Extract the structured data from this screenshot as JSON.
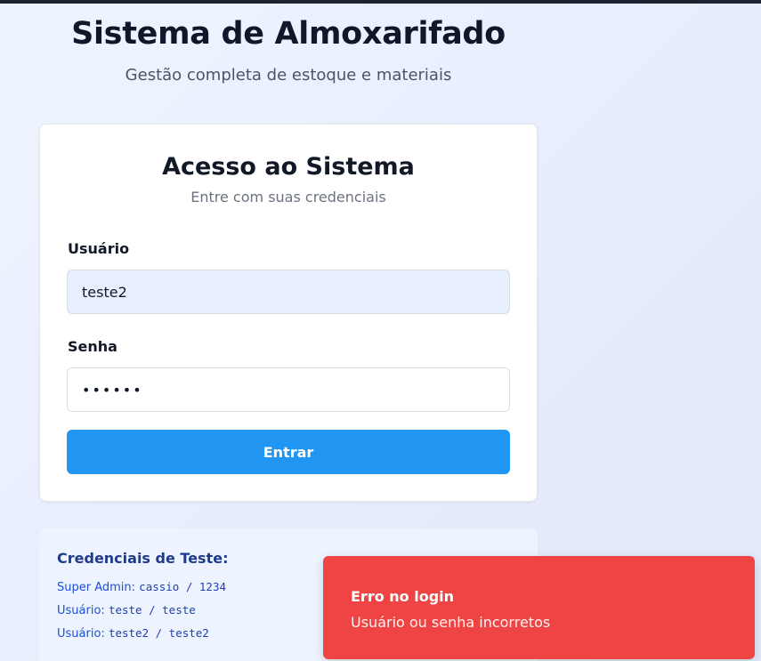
{
  "header": {
    "title": "Sistema de Almoxarifado",
    "subtitle": "Gestão completa de estoque e materiais"
  },
  "login": {
    "title": "Acesso ao Sistema",
    "subtitle": "Entre com suas credenciais",
    "username_label": "Usuário",
    "username_value": "teste2",
    "password_label": "Senha",
    "password_value": "••••••",
    "submit_label": "Entrar"
  },
  "credentials": {
    "title": "Credenciais de Teste:",
    "items": [
      {
        "role": "Super Admin:",
        "value": "cassio / 1234"
      },
      {
        "role": "Usuário:",
        "value": "teste / teste"
      },
      {
        "role": "Usuário:",
        "value": "teste2 / teste2"
      }
    ]
  },
  "toast": {
    "title": "Erro no login",
    "message": "Usuário ou senha incorretos"
  },
  "colors": {
    "primary_button": "#2195f2",
    "error_toast": "#ef4444",
    "credentials_text": "#1d4ed8"
  }
}
